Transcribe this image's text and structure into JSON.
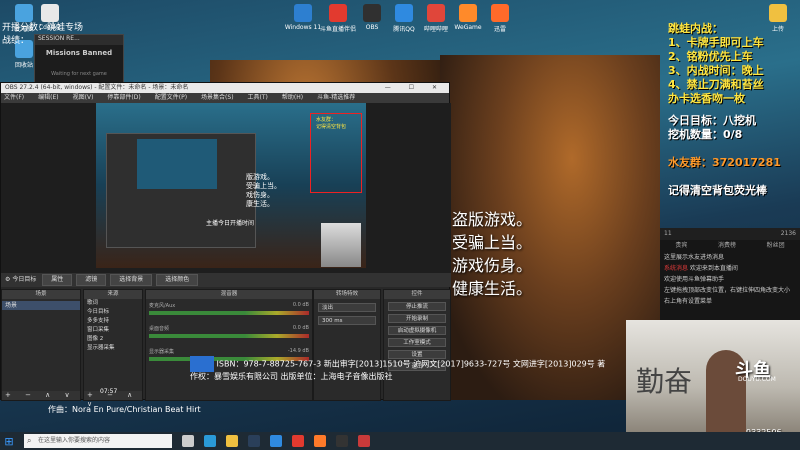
{
  "desktop_icons": [
    {
      "label": "此电脑",
      "color": "#4aa3df"
    },
    {
      "label": "Cdesk2",
      "color": "#e8e8e8"
    },
    {
      "label": "Windows 11",
      "color": "#2d7fd0"
    },
    {
      "label": "斗鱼直播伴侣",
      "color": "#e23a2f"
    },
    {
      "label": "OBS",
      "color": "#303030"
    },
    {
      "label": "腾讯QQ",
      "color": "#2f8ae0"
    },
    {
      "label": "哔哩哔哩",
      "color": "#e0463a"
    },
    {
      "label": "WeGame",
      "color": "#ff8a2a"
    },
    {
      "label": "迅雷",
      "color": "#ff6a2a"
    },
    {
      "label": "上传",
      "color": "#f0c040"
    },
    {
      "label": "回收站",
      "color": "#4aa3df"
    }
  ],
  "left_overlay": {
    "line1": "开播分数：跳蛙专场",
    "line2": "战绩："
  },
  "session_panel": {
    "header": "SESSION RE...",
    "title": "Missions Banned",
    "status": "Waiting for next game"
  },
  "right_overlay": {
    "title": "跳蛙内战：",
    "rules": [
      "1、卡牌手即可上车",
      "2、铭粉优先上车",
      "3、内战时间：晚上",
      "4、禁止刀满和苔丝",
      "办卡选香吻一枚"
    ],
    "target": "今日目标：八挖机",
    "count": "挖机数量：0/8",
    "fan_group": "水友群：372017281",
    "bag_note": "记得清空背包荧光棒"
  },
  "obs": {
    "window_title": "OBS 27.2.4 (64-bit, windows) - 配置文件：未命名 - 场景：未命名",
    "window_controls": "— ☐ ✕",
    "menu": [
      "文件(F)",
      "编辑(E)",
      "视图(V)",
      "停靠部件(D)",
      "配置文件(P)",
      "场景集合(S)",
      "工具(T)",
      "帮助(H)",
      "斗鱼-精选推荐"
    ],
    "toolbar_label": "今日目标",
    "toolbar_buttons": [
      "属性",
      "滤镜",
      "选择背景",
      "选择颜色"
    ],
    "preview_text": [
      "版游戏。",
      "受骗上当。",
      "戏伤身。",
      "康生活。"
    ],
    "preview_label": "主播今日开播时间",
    "preview_redtext": [
      "水友群：",
      "记得清空背包"
    ],
    "docks": {
      "scenes_title": "场景",
      "scenes": [
        "场景"
      ],
      "sources_title": "来源",
      "sources": [
        "歌词",
        "今日目标",
        "多多支持",
        "窗口采集",
        "图像 2",
        "显示器采集"
      ],
      "mixer_title": "混音器",
      "mixer_rows": [
        {
          "label": "麦克风/Aux",
          "value": "0.0 dB"
        },
        {
          "label": "桌面音频",
          "value": "0.0 dB"
        },
        {
          "label": "显示器采集",
          "value": "-14.9 dB"
        }
      ],
      "transitions_title": "转场特效",
      "transition": "淡出",
      "duration": "300 ms",
      "controls_title": "控件",
      "controls": [
        "停止推流",
        "开始录制",
        "启动虚拟摄像机",
        "工作室模式",
        "设置",
        "退出"
      ],
      "footer_icons": "+ − ∧ ∨"
    }
  },
  "game_subtitle": [
    "盗版游戏。",
    "受骗上当。",
    "游戏伤身。",
    "健康生活。"
  ],
  "isbn_text": "ISBN：978-7-88725-767-3 新出审字[2013]1510号 沪网文[2017]9633-727号 文网进字[2013]029号 著作权：暴雪娱乐有限公司 出版单位：上海电子音像出版社",
  "time_code": "07:57",
  "track": "作曲：Nora En Pure/Christian Beat Hirt",
  "chat": {
    "tabs": [
      "贵宾",
      "消费榜",
      "粉丝团"
    ],
    "stats_left": "11",
    "stats_right": "2136",
    "messages": [
      {
        "prefix": "",
        "text": "这里展示水友进场消息"
      },
      {
        "prefix": "系统消息",
        "text": "欢迎来到本直播间"
      },
      {
        "prefix": "",
        "text": "欢迎使用斗鱼弹幕助手"
      },
      {
        "prefix": "",
        "text": "左键拖拽顶部改变位置，右键拉伸四角改变大小"
      },
      {
        "prefix": "",
        "text": "右上角有设置菜单"
      }
    ]
  },
  "webcam": {
    "calligraphy": "勤奋",
    "brand": "斗鱼",
    "brand_url": "DOUYU.COM",
    "room_number": "9332506"
  },
  "taskbar": {
    "search_placeholder": "在这里输入你要搜索的内容",
    "apps": [
      {
        "name": "task-view-icon",
        "color": "#cccccc"
      },
      {
        "name": "edge-icon",
        "color": "#2a9ad8"
      },
      {
        "name": "explorer-icon",
        "color": "#f0c040"
      },
      {
        "name": "steam-icon",
        "color": "#2a3f5a"
      },
      {
        "name": "qq-icon",
        "color": "#2f8ae0"
      },
      {
        "name": "netease-icon",
        "color": "#e23a2f"
      },
      {
        "name": "douyu-icon",
        "color": "#ff7a2a"
      },
      {
        "name": "obs-icon",
        "color": "#333333"
      },
      {
        "name": "game-icon",
        "color": "#c83a3a"
      }
    ]
  }
}
